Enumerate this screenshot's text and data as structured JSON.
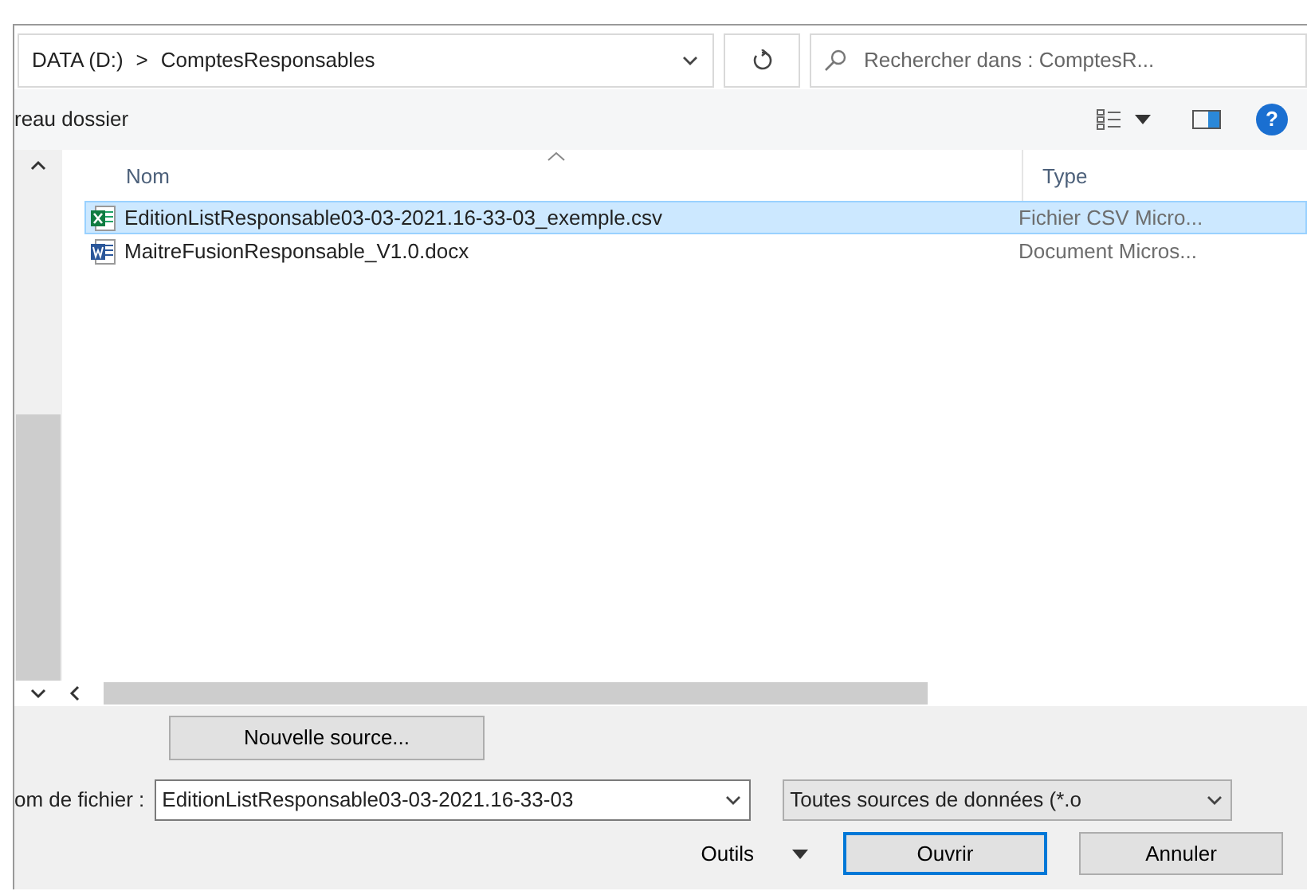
{
  "address_bar": {
    "segments": [
      "DATA (D:)",
      "ComptesResponsables"
    ],
    "separator": ">"
  },
  "search": {
    "placeholder": "Rechercher dans : ComptesR..."
  },
  "toolbar": {
    "new_folder": "reau dossier",
    "help": "?"
  },
  "columns": [
    {
      "label": "Nom",
      "sorted": true
    },
    {
      "label": "Type",
      "sorted": false
    }
  ],
  "files": [
    {
      "name": "EditionListResponsable03-03-2021.16-33-03_exemple.csv",
      "type": "Fichier CSV Micro...",
      "kind": "excel",
      "selected": true
    },
    {
      "name": "MaitreFusionResponsable_V1.0.docx",
      "type": "Document Micros...",
      "kind": "word",
      "selected": false
    }
  ],
  "new_source_button": "Nouvelle source...",
  "filename": {
    "label": "om de fichier :",
    "value": "EditionListResponsable03-03-2021.16-33-03"
  },
  "filter": {
    "value": "Toutes sources de données (*.o"
  },
  "buttons": [
    {
      "label": "Outils",
      "kind": "menu"
    },
    {
      "label": "Ouvrir",
      "kind": "default"
    },
    {
      "label": "Annuler",
      "kind": "normal"
    }
  ]
}
